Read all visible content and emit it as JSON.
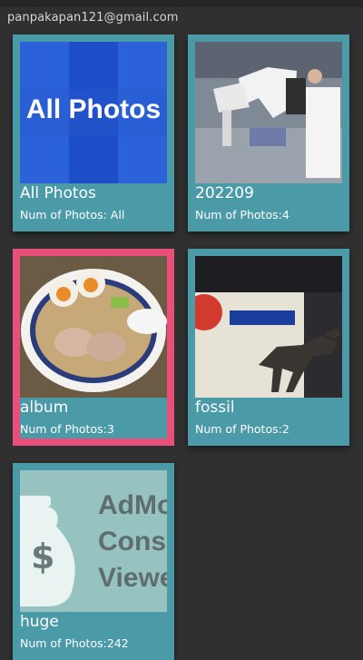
{
  "account": {
    "email": "panpakapan121@gmail.com"
  },
  "albums": [
    {
      "title": "All Photos",
      "count_label": "Num of Photos: All",
      "thumb_text": "All Photos",
      "selected": false
    },
    {
      "title": "202209",
      "count_label": "Num of Photos:4",
      "selected": false
    },
    {
      "title": "album",
      "count_label": "Num of Photos:3",
      "selected": true
    },
    {
      "title": "fossil",
      "count_label": "Num of Photos:2",
      "selected": false
    },
    {
      "title": "huge",
      "count_label": "Num of Photos:242",
      "thumb_text_lines": [
        "AdMo",
        "Conso",
        "Viewe"
      ],
      "selected": false
    }
  ],
  "colors": {
    "card": "#4a9aa8",
    "selected_border": "#e8507a",
    "background": "#303030"
  }
}
